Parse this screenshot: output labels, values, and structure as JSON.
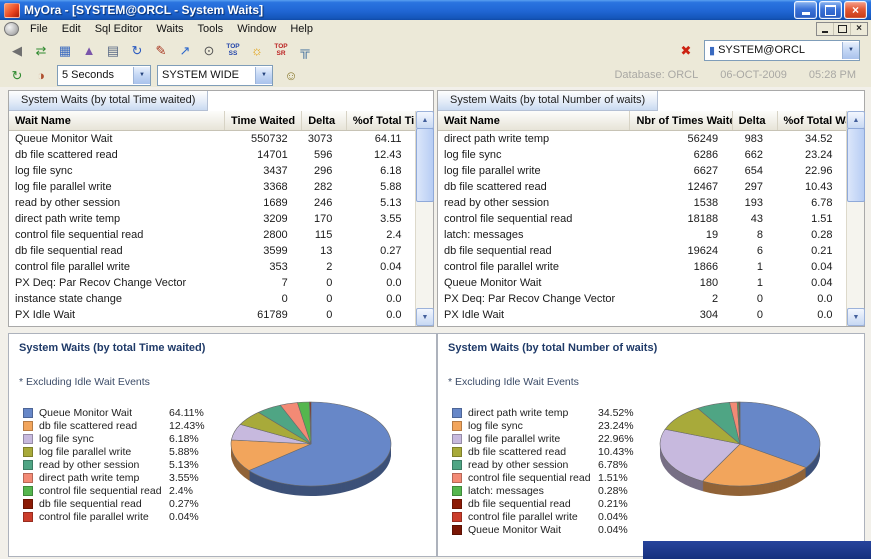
{
  "titlebar": {
    "title": "MyOra - [SYSTEM@ORCL - System Waits]"
  },
  "menu": {
    "items": [
      "File",
      "Edit",
      "Sql Editor",
      "Waits",
      "Tools",
      "Window",
      "Help"
    ]
  },
  "toolbar": {
    "icons_main": [
      "speaker",
      "connect",
      "windows",
      "send",
      "print",
      "refresh-data",
      "notes",
      "chart",
      "inspect",
      "top-ss",
      "lamp",
      "top-sr",
      "hierarchy"
    ],
    "icon_disconnect": "disconnect",
    "icon_db": "db",
    "icons_refresh": [
      "auto-refresh",
      "snapshot"
    ],
    "icons_session": [
      "sessions"
    ],
    "top_ss_line1": "TOP",
    "top_ss_line2": "SS",
    "top_sr_line1": "TOP",
    "top_sr_line2": "SR",
    "connection_value": "SYSTEM@ORCL",
    "interval_value": "5 Seconds",
    "scope_value": "SYSTEM WIDE",
    "status_database": "Database: ORCL",
    "status_date": "06-OCT-2009",
    "status_time": "05:28 PM"
  },
  "tables": {
    "time": {
      "tab_title": "System Waits (by total Time waited)",
      "columns": [
        "Wait Name",
        "Time Waited",
        "Delta",
        "%of Total Time"
      ],
      "rows": [
        [
          "Queue Monitor Wait",
          "550732",
          "3073",
          "64.11"
        ],
        [
          "db file scattered read",
          "14701",
          "596",
          "12.43"
        ],
        [
          "log file sync",
          "3437",
          "296",
          "6.18"
        ],
        [
          "log file parallel write",
          "3368",
          "282",
          "5.88"
        ],
        [
          "read by other session",
          "1689",
          "246",
          "5.13"
        ],
        [
          "direct path write temp",
          "3209",
          "170",
          "3.55"
        ],
        [
          "control file sequential read",
          "2800",
          "115",
          "2.4"
        ],
        [
          "db file sequential read",
          "3599",
          "13",
          "0.27"
        ],
        [
          "control file parallel write",
          "353",
          "2",
          "0.04"
        ],
        [
          "PX Deq: Par Recov Change Vector",
          "7",
          "0",
          "0.0"
        ],
        [
          "instance state change",
          "0",
          "0",
          "0.0"
        ],
        [
          "PX Idle Wait",
          "61789",
          "0",
          "0.0"
        ]
      ]
    },
    "count": {
      "tab_title": "System Waits (by total Number of waits)",
      "columns": [
        "Wait Name",
        "Nbr of Times Waited",
        "Delta",
        "%of Total Waits"
      ],
      "rows": [
        [
          "direct path write temp",
          "56249",
          "983",
          "34.52"
        ],
        [
          "log file sync",
          "6286",
          "662",
          "23.24"
        ],
        [
          "log file parallel write",
          "6627",
          "654",
          "22.96"
        ],
        [
          "db file scattered read",
          "12467",
          "297",
          "10.43"
        ],
        [
          "read by other session",
          "1538",
          "193",
          "6.78"
        ],
        [
          "control file sequential read",
          "18188",
          "43",
          "1.51"
        ],
        [
          "latch: messages",
          "19",
          "8",
          "0.28"
        ],
        [
          "db file sequential read",
          "19624",
          "6",
          "0.21"
        ],
        [
          "control file parallel write",
          "1866",
          "1",
          "0.04"
        ],
        [
          "Queue Monitor Wait",
          "180",
          "1",
          "0.04"
        ],
        [
          "PX Deq: Par Recov Change Vector",
          "2",
          "0",
          "0.0"
        ],
        [
          "PX Idle Wait",
          "304",
          "0",
          "0.0"
        ]
      ]
    }
  },
  "chart_data": [
    {
      "type": "pie",
      "title": "System Waits (by total Time waited)",
      "note": "* Excluding Idle Wait Events",
      "legend_position": "left",
      "style": "3d-pie",
      "slices": [
        {
          "label": "Queue Monitor Wait",
          "pct": "64.11%",
          "value": 64.11,
          "color": "#6787c8"
        },
        {
          "label": "db file scattered read",
          "pct": "12.43%",
          "value": 12.43,
          "color": "#f2a55c"
        },
        {
          "label": "log file sync",
          "pct": "6.18%",
          "value": 6.18,
          "color": "#c7b9de"
        },
        {
          "label": "log file parallel write",
          "pct": "5.88%",
          "value": 5.88,
          "color": "#a8aa3a"
        },
        {
          "label": "read by other session",
          "pct": "5.13%",
          "value": 5.13,
          "color": "#4fa584"
        },
        {
          "label": "direct path write temp",
          "pct": "3.55%",
          "value": 3.55,
          "color": "#f38a75"
        },
        {
          "label": "control file sequential read",
          "pct": "2.4%",
          "value": 2.4,
          "color": "#55b64e"
        },
        {
          "label": "db file sequential read",
          "pct": "0.27%",
          "value": 0.27,
          "color": "#8c1b06"
        },
        {
          "label": "control file parallel write",
          "pct": "0.04%",
          "value": 0.04,
          "color": "#cb3d2b"
        }
      ]
    },
    {
      "type": "pie",
      "title": "System Waits (by total Number of waits)",
      "note": "* Excluding Idle Wait Events",
      "legend_position": "left",
      "style": "3d-pie",
      "slices": [
        {
          "label": "direct path write temp",
          "pct": "34.52%",
          "value": 34.52,
          "color": "#6787c8"
        },
        {
          "label": "log file sync",
          "pct": "23.24%",
          "value": 23.24,
          "color": "#f2a55c"
        },
        {
          "label": "log file parallel write",
          "pct": "22.96%",
          "value": 22.96,
          "color": "#c7b9de"
        },
        {
          "label": "db file scattered read",
          "pct": "10.43%",
          "value": 10.43,
          "color": "#a8aa3a"
        },
        {
          "label": "read by other session",
          "pct": "6.78%",
          "value": 6.78,
          "color": "#4fa584"
        },
        {
          "label": "control file sequential read",
          "pct": "1.51%",
          "value": 1.51,
          "color": "#f38a75"
        },
        {
          "label": "latch: messages",
          "pct": "0.28%",
          "value": 0.28,
          "color": "#55b64e"
        },
        {
          "label": "db file sequential read",
          "pct": "0.21%",
          "value": 0.21,
          "color": "#8c1b06"
        },
        {
          "label": "control file parallel write",
          "pct": "0.04%",
          "value": 0.04,
          "color": "#cb3d2b"
        },
        {
          "label": "Queue Monitor Wait",
          "pct": "0.04%",
          "value": 0.04,
          "color": "#7a1605"
        }
      ]
    }
  ]
}
